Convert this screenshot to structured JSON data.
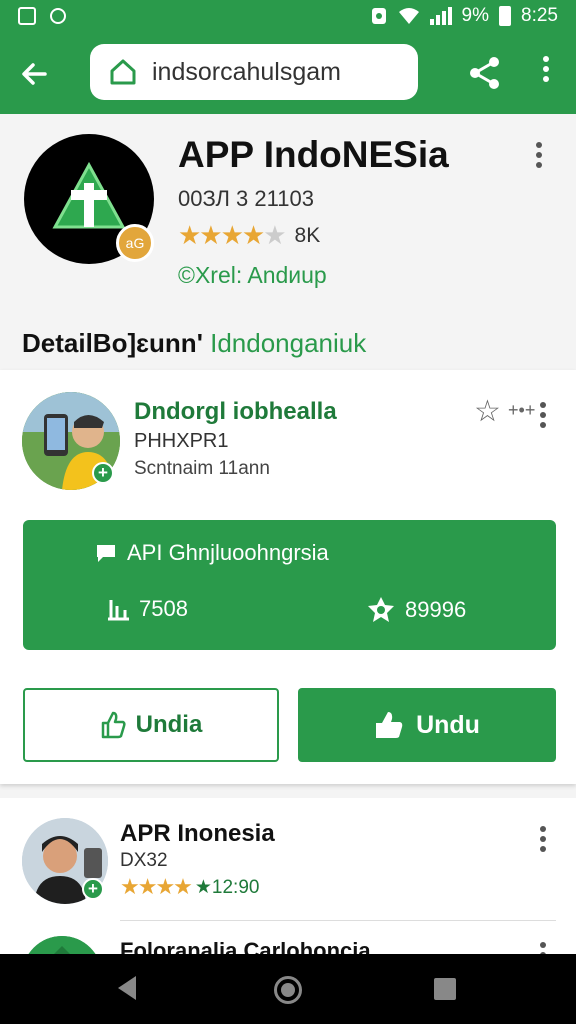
{
  "status_bar": {
    "battery": "9%",
    "time": "8:25",
    "icons": [
      "screenshot-icon",
      "chat-bubble-icon",
      "alarm-icon",
      "wifi-icon",
      "signal-icon",
      "battery-icon"
    ]
  },
  "toolbar": {
    "back_icon": "back-arrow-icon",
    "url": "indsorcahulsgam",
    "home_icon": "home-icon",
    "share_icon": "share-icon",
    "more_icon": "more-vert-icon"
  },
  "app": {
    "title": "APP IndoNESia",
    "id_line": "00ЗЛ 3 21103",
    "stars": 4,
    "rating_count": "8K",
    "subtitle": "©Xrel: Andиup",
    "badge_text": "aG"
  },
  "section": {
    "title_dark": "DetailBo]ɛunn'",
    "title_accent": "Idndonganiuk"
  },
  "card1": {
    "name": "Dndorgl iobhealla",
    "code": "PHHXPR1",
    "meta": "Scntnaim 11ann",
    "arrows": "+•+",
    "panel_title": "API Ghnjluoohngrsia",
    "stat1": "7508",
    "stat2": "89996",
    "btn_outline": "Undia",
    "btn_fill": "Undu",
    "colors": {
      "accent": "#2a9a4b"
    }
  },
  "card2": {
    "name": "APR Inonesia",
    "code": "DX32",
    "stars": 4,
    "rating_count": "★12:90"
  },
  "card3": {
    "name": "Foloranalia Carlohoncia"
  }
}
